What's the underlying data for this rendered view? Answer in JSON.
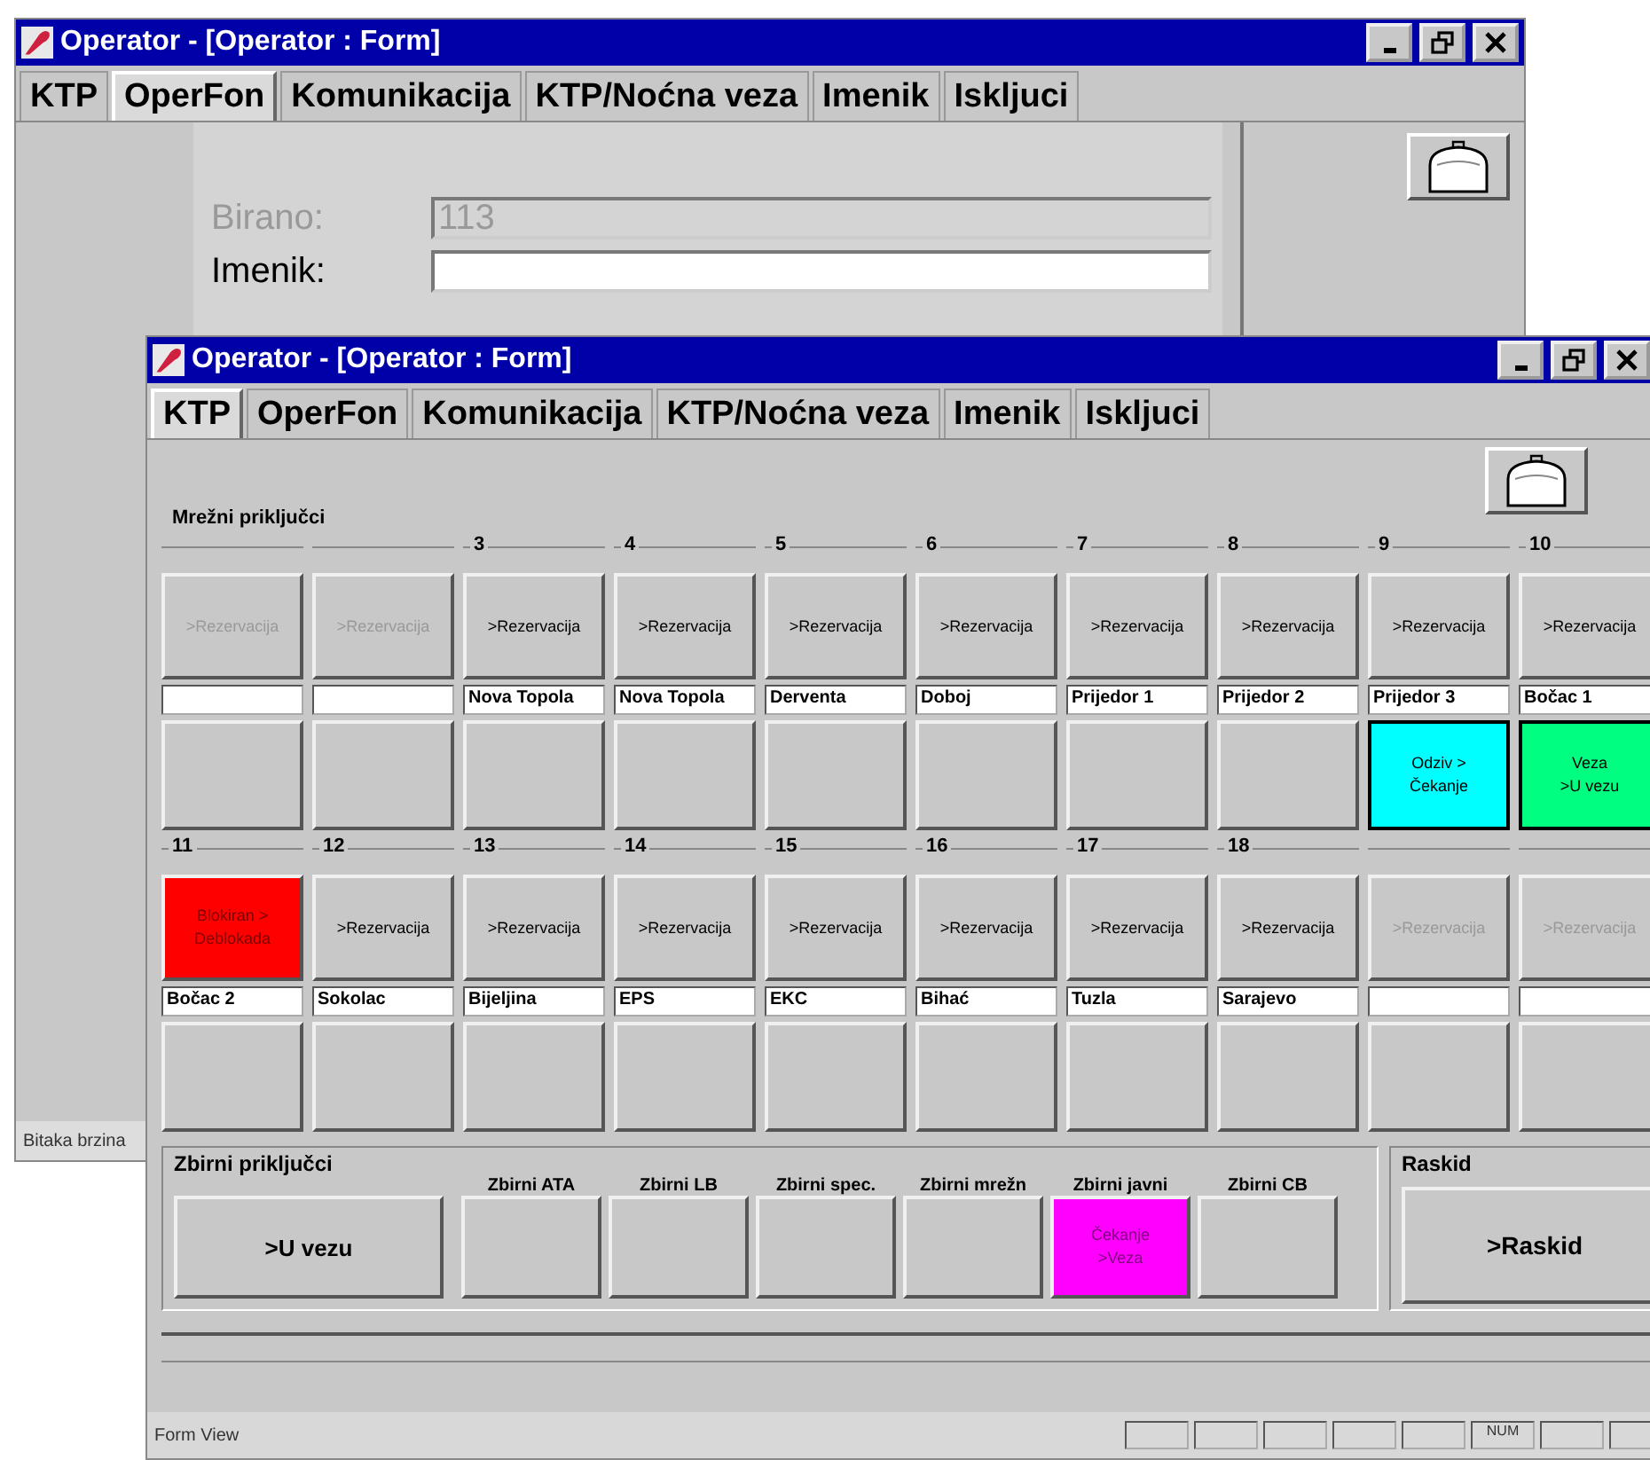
{
  "back_window": {
    "title": "Operator - [Operator : Form]",
    "tabs": [
      {
        "label": "KTP",
        "selected": false
      },
      {
        "label": "OperFon",
        "selected": true
      },
      {
        "label": "Komunikacija",
        "selected": false
      },
      {
        "label": "KTP/Noćna veza",
        "selected": false
      },
      {
        "label": "Imenik",
        "selected": false
      },
      {
        "label": "Iskljuci",
        "selected": false
      }
    ],
    "birano": {
      "label": "Birano:",
      "value": "113",
      "disabled": true
    },
    "imenik": {
      "label": "Imenik:",
      "disabled": false
    },
    "status_bar": "Bitaka brzina"
  },
  "front_window": {
    "title": "Operator - [Operator : Form]",
    "tabs": [
      {
        "label": "KTP",
        "selected": true
      },
      {
        "label": "OperFon",
        "selected": false
      },
      {
        "label": "Komunikacija",
        "selected": false
      },
      {
        "label": "KTP/Noćna veza",
        "selected": false
      },
      {
        "label": "Imenik",
        "selected": false
      },
      {
        "label": "Iskljuci",
        "selected": false
      }
    ],
    "network_group": {
      "title": "Mrežni priključci",
      "rows": [
        [
          {
            "disabled": true,
            "action": ">Rezervacija"
          },
          {
            "disabled": true,
            "action": ">Rezervacija"
          },
          {
            "number": "3",
            "disabled": false,
            "action": ">Rezervacija",
            "name": "Nova Topola"
          },
          {
            "number": "4",
            "disabled": false,
            "action": ">Rezervacija",
            "name": "Nova Topola"
          },
          {
            "number": "5",
            "disabled": false,
            "action": ">Rezervacija",
            "name": "Derventa"
          },
          {
            "number": "6",
            "disabled": false,
            "action": ">Rezervacija",
            "name": "Doboj"
          },
          {
            "number": "7",
            "disabled": false,
            "action": ">Rezervacija",
            "name": "Prijedor 1"
          },
          {
            "number": "8",
            "disabled": false,
            "action": ">Rezervacija",
            "name": "Prijedor 2"
          },
          {
            "number": "9",
            "disabled": false,
            "action": ">Rezervacija",
            "name": "Prijedor 3",
            "status": {
              "label": "Odziv >\nČekanje",
              "color": "#00ffff"
            }
          },
          {
            "number": "10",
            "disabled": false,
            "action": ">Rezervacija",
            "name": "Bočac 1",
            "status": {
              "label": "Veza\n>U vezu",
              "color": "#00ff80"
            }
          }
        ],
        [
          {
            "number": "11",
            "disabled": false,
            "action": "Blokiran >\nDeblokada",
            "color": "#ff0000",
            "name": "Bočac 2"
          },
          {
            "number": "12",
            "disabled": false,
            "action": ">Rezervacija",
            "name": "Sokolac"
          },
          {
            "number": "13",
            "disabled": false,
            "action": ">Rezervacija",
            "name": "Bijeljina"
          },
          {
            "number": "14",
            "disabled": false,
            "action": ">Rezervacija",
            "name": "EPS"
          },
          {
            "number": "15",
            "disabled": false,
            "action": ">Rezervacija",
            "name": "EKC"
          },
          {
            "number": "16",
            "disabled": false,
            "action": ">Rezervacija",
            "name": "Bihać"
          },
          {
            "number": "17",
            "disabled": false,
            "action": ">Rezervacija",
            "name": "Tuzla"
          },
          {
            "number": "18",
            "disabled": false,
            "action": ">Rezervacija",
            "name": "Sarajevo"
          },
          {
            "disabled": true,
            "action": ">Rezervacija"
          },
          {
            "disabled": true,
            "action": ">Rezervacija"
          }
        ]
      ]
    },
    "collective_group": {
      "title": "Zbirni priključci",
      "main_button": ">U vezu",
      "items": [
        {
          "label": "Zbirni ATA"
        },
        {
          "label": "Zbirni LB"
        },
        {
          "label": "Zbirni spec."
        },
        {
          "label": "Zbirni mrežn"
        },
        {
          "label": "Zbirni javni",
          "status": "Čekanje\n>Veza",
          "color": "#ff00ff"
        },
        {
          "label": "Zbirni CB"
        }
      ]
    },
    "disconnect_group": {
      "title": "Raskid",
      "button": ">Raskid"
    },
    "status_bar": {
      "text": "Form View",
      "indicator": "NUM"
    }
  }
}
